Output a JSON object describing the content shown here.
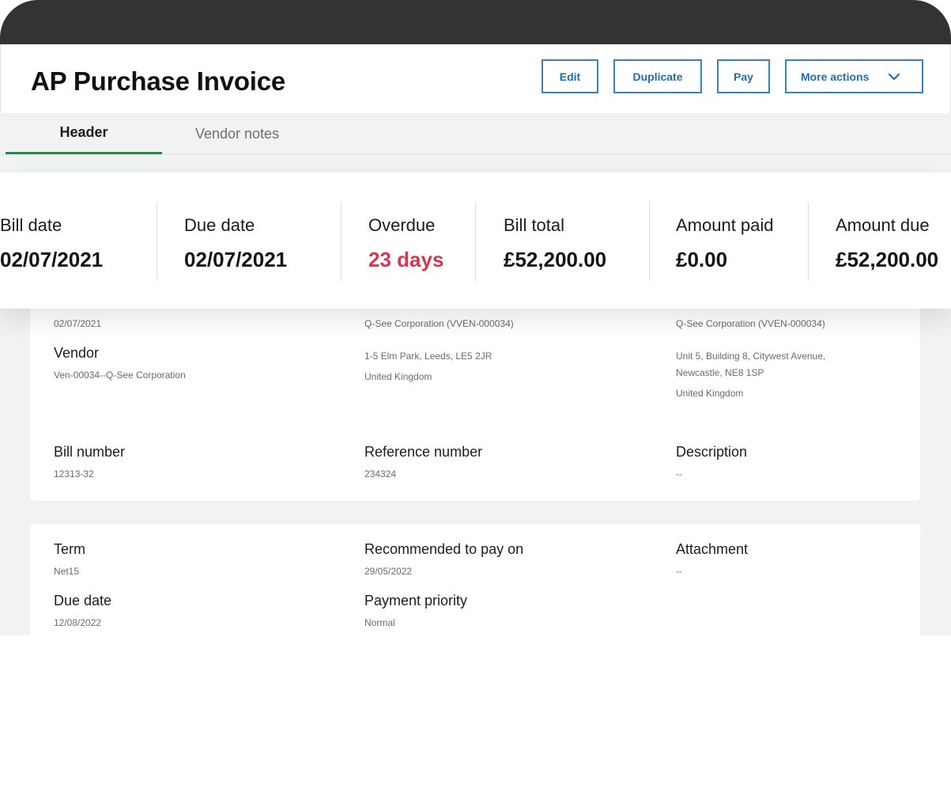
{
  "page": {
    "title": "AP Purchase Invoice"
  },
  "toolbar": {
    "edit_label": "Edit",
    "duplicate_label": "Duplicate",
    "pay_label": "Pay",
    "more_actions_label": "More actions",
    "more_actions_icon": "chevron-down-icon"
  },
  "tabs": [
    {
      "label": "Header",
      "active": true
    },
    {
      "label": "Vendor notes",
      "active": false
    }
  ],
  "summary": [
    {
      "label": "Bill date",
      "value": "02/07/2021"
    },
    {
      "label": "Due date",
      "value": "02/07/2021"
    },
    {
      "label": "Overdue",
      "value": "23 days"
    },
    {
      "label": "Bill total",
      "value": "£52,200.00"
    },
    {
      "label": "Amount paid",
      "value": "£0.00"
    },
    {
      "label": "Amount due",
      "value": "£52,200.00"
    }
  ],
  "details": {
    "bill_date_value": "02/07/2021",
    "vendor_label": "Vendor",
    "vendor_value": "Ven-00034--Q-See Corporation",
    "pay_to": {
      "name": "Q-See Corporation (VVEN-000034)",
      "address_line": "1-5 Elm Park, Leeds, LE5 2JR",
      "country": "United Kingdom"
    },
    "return_to": {
      "name": "Q-See Corporation (VVEN-000034)",
      "address_line1": "Unit 5, Building 8, Citywest Avenue,",
      "address_line2": "Newcastle, NE8 1SP",
      "country": "United Kingdom"
    },
    "bill_number_label": "Bill number",
    "bill_number_value": "12313-32",
    "reference_number_label": "Reference number",
    "reference_number_value": "234324",
    "description_label": "Description",
    "description_value": "--"
  },
  "terms": {
    "term_label": "Term",
    "term_value": "Net15",
    "due_date_label": "Due date",
    "due_date_value": "12/08/2022",
    "recommended_label": "Recommended to pay on",
    "recommended_value": "29/05/2022",
    "priority_label": "Payment priority",
    "priority_value": "Normal",
    "attachment_label": "Attachment",
    "attachment_value": "--"
  },
  "colors": {
    "accent_green": "#1f8a4c",
    "overdue_red": "#d4374f",
    "button_blue": "#1f6fae",
    "device_frame": "#333333"
  }
}
